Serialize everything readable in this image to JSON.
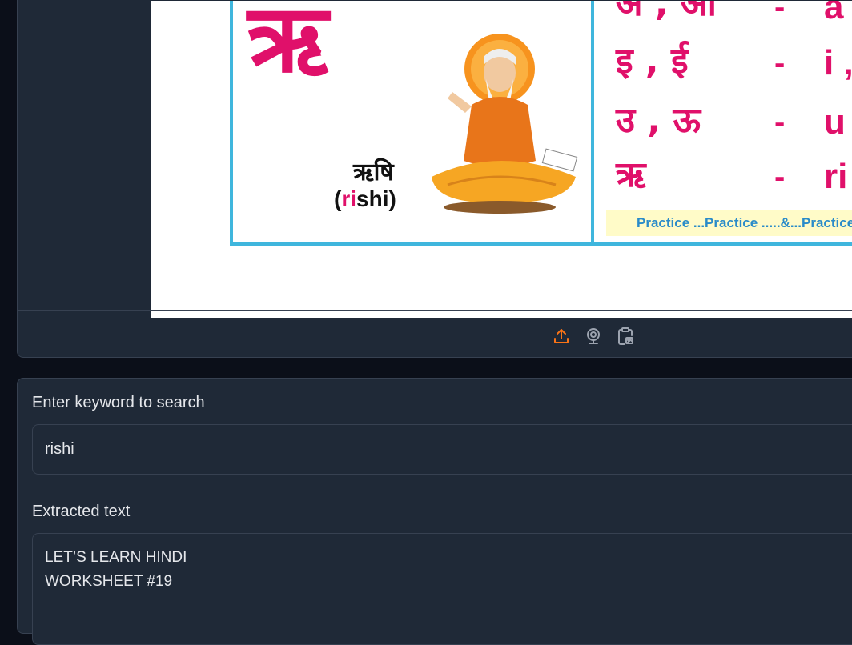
{
  "image_panel": {
    "worksheet": {
      "big_letter": "ऋ",
      "word_hindi": "ऋषि",
      "word_latin_open": "(",
      "word_latin_pink": "ri",
      "word_latin_rest": "shi)",
      "rows": [
        {
          "hindi": "अ , आ",
          "latin": "a"
        },
        {
          "hindi": "इ , ई",
          "latin": "i ,"
        },
        {
          "hindi": "उ , ऊ",
          "latin": "u"
        },
        {
          "hindi": "ऋ",
          "latin": "ri"
        }
      ],
      "dash": "-",
      "practice": "Practice ...Practice .....&...Practice"
    },
    "toolbar": {
      "upload_icon": "upload-icon",
      "webcam_icon": "webcam-icon",
      "clipboard_icon": "clipboard-paste-icon",
      "accent_color": "#f97316"
    }
  },
  "search": {
    "label": "Enter keyword to search",
    "value": "rishi"
  },
  "extracted": {
    "label": "Extracted text",
    "lines": [
      "LET’S LEARN HINDI",
      "WORKSHEET #19"
    ]
  }
}
